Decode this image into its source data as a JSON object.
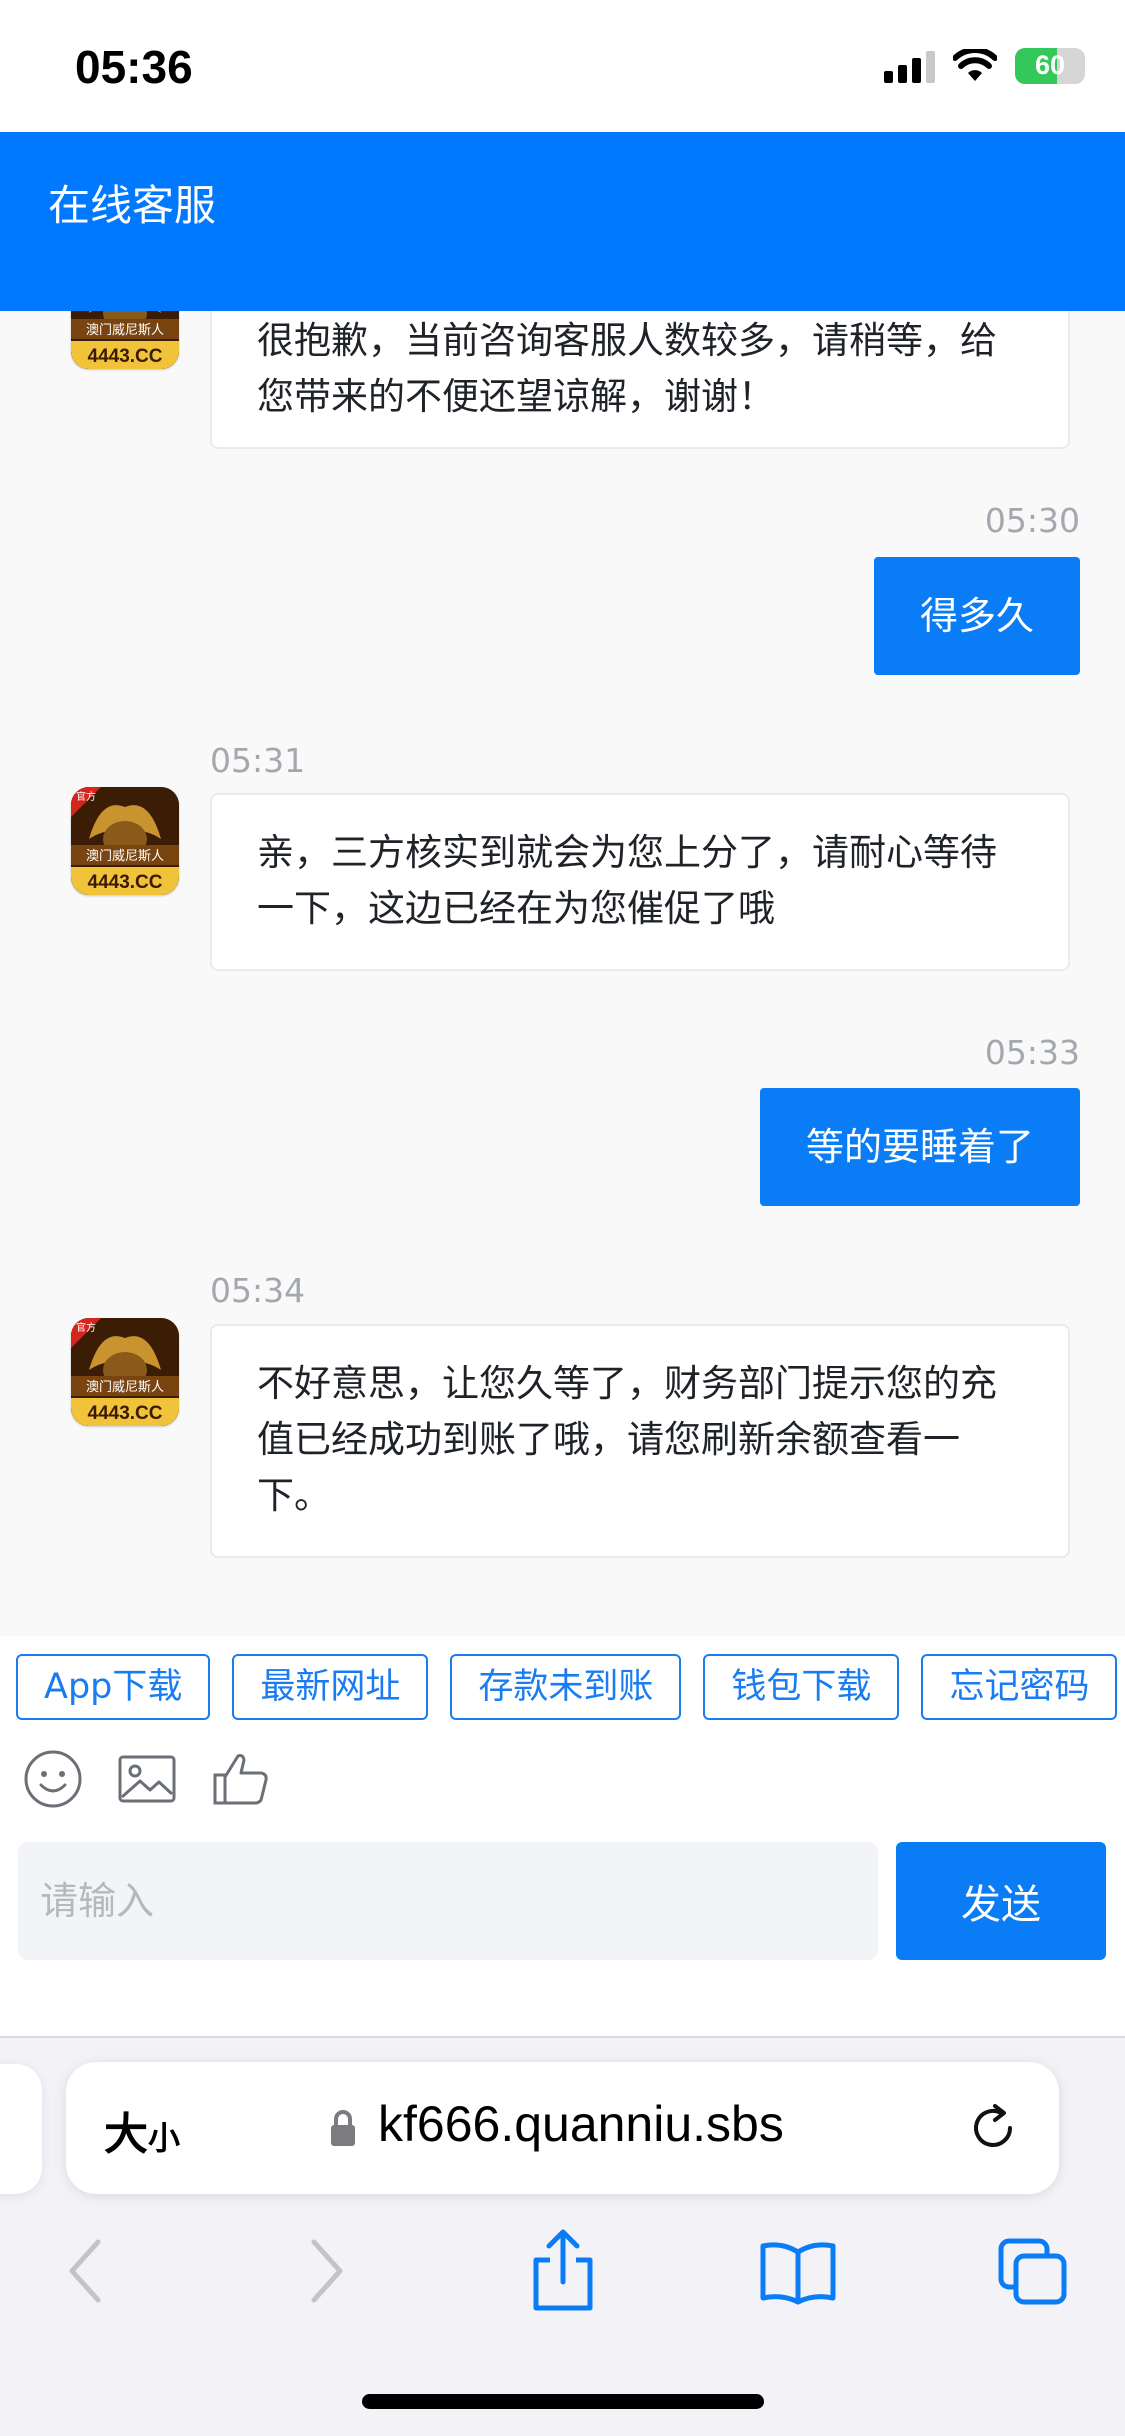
{
  "status_bar": {
    "time": "05:36",
    "battery": "60",
    "battery_level": 0.6
  },
  "header": {
    "title": "在线客服"
  },
  "messages": [
    {
      "type": "incoming",
      "time": "",
      "text": "很抱歉，当前咨询客服人数较多，请稍等，给您带来的不便还望谅解，谢谢！"
    },
    {
      "type": "outgoing",
      "time": "05:30",
      "text": "得多久"
    },
    {
      "type": "incoming",
      "time": "05:31",
      "text": "亲，三方核实到就会为您上分了，请耐心等待一下，这边已经在为您催促了哦"
    },
    {
      "type": "outgoing",
      "time": "05:33",
      "text": "等的要睡着了"
    },
    {
      "type": "incoming",
      "time": "05:34",
      "text": "不好意思，让您久等了，财务部门提示您的充值已经成功到账了哦，请您刷新余额查看一下。"
    }
  ],
  "avatar": {
    "badge": "官方",
    "brand": "澳门威尼斯人",
    "site": "4443.CC"
  },
  "quick_replies": [
    "App下载",
    "最新网址",
    "存款未到账",
    "钱包下载",
    "忘记密码"
  ],
  "input": {
    "placeholder": "请输入",
    "value": ""
  },
  "send_label": "发送",
  "browser": {
    "text_size_label_big": "大",
    "text_size_label_small": "小",
    "url": "kf666.quanniu.sbs"
  },
  "colors": {
    "primary": "#0079fe",
    "bubble_out": "#0a7df6",
    "avatar_bg": "#7a3b0c"
  }
}
